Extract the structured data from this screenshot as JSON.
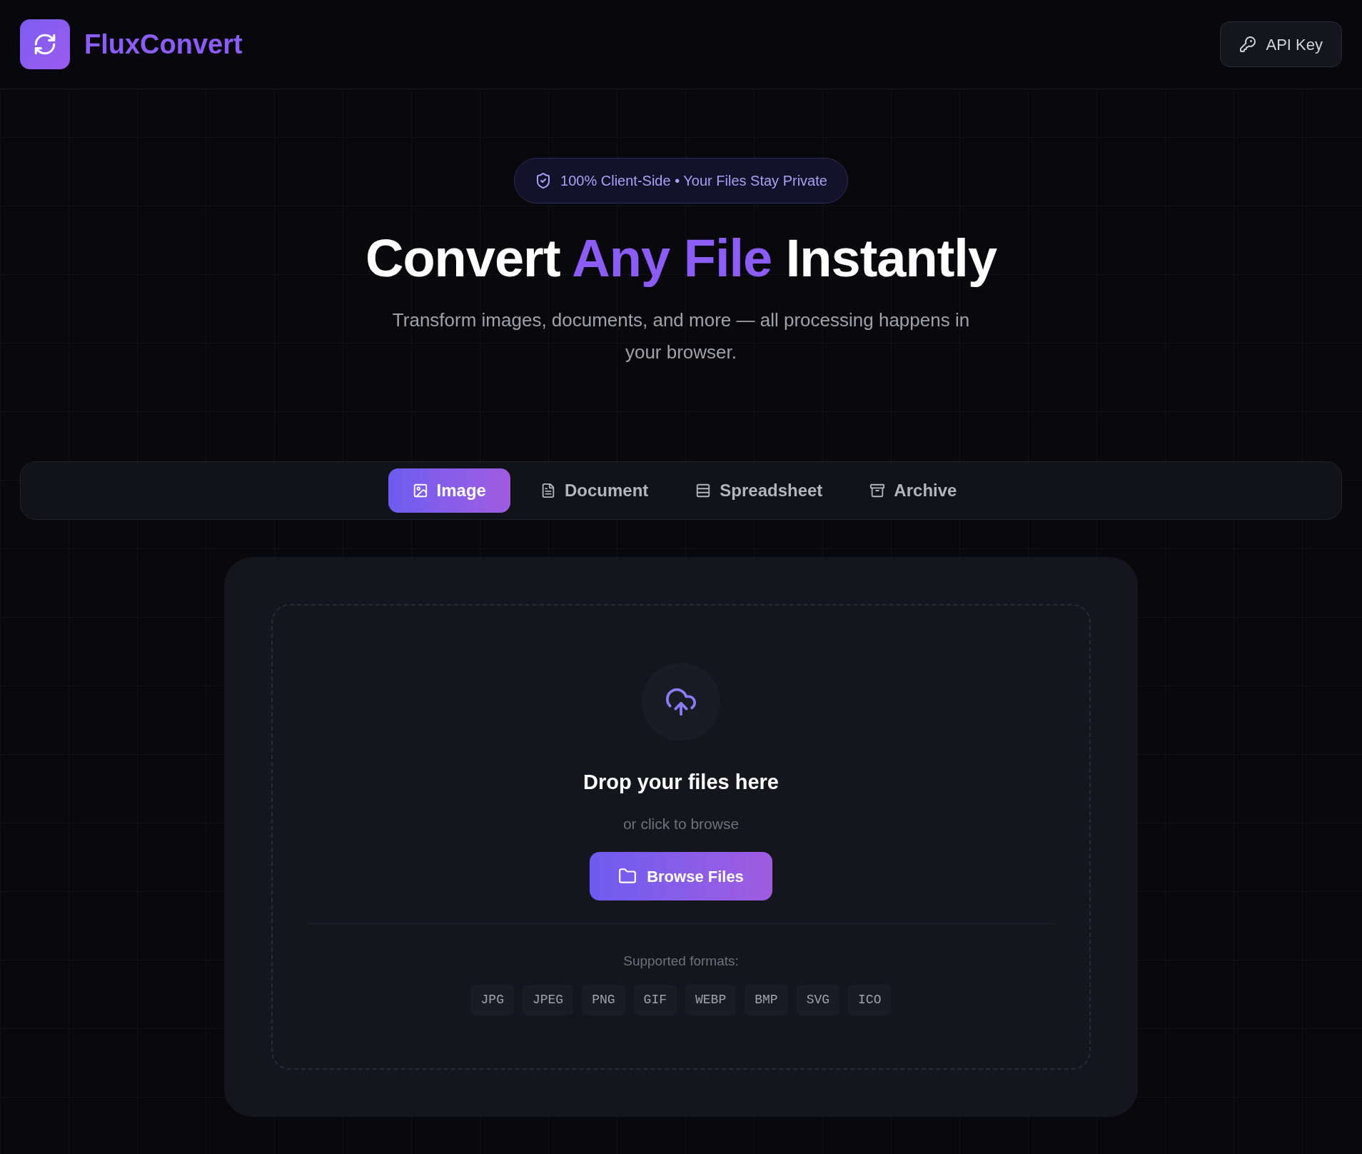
{
  "header": {
    "brand": "FluxConvert",
    "api_button": "API Key"
  },
  "hero": {
    "badge": "100% Client-Side • Your Files Stay Private",
    "title": [
      {
        "text": "Convert",
        "highlight": false
      },
      {
        "text": "Any File",
        "highlight": true
      },
      {
        "text": "Instantly",
        "highlight": false
      }
    ],
    "subtitle": "Transform images, documents, and more — all processing happens in your browser."
  },
  "tabs": [
    {
      "label": "Image",
      "kind": "image",
      "selected": true
    },
    {
      "label": "Document",
      "kind": "document",
      "selected": false
    },
    {
      "label": "Spreadsheet",
      "kind": "spreadsheet",
      "selected": false
    },
    {
      "label": "Archive",
      "kind": "archive",
      "selected": false
    }
  ],
  "dropzone": {
    "title": "Drop your files here",
    "hint": "or click to browse",
    "button": "Browse Files",
    "formats_label": "Supported formats:",
    "formats": [
      "JPG",
      "JPEG",
      "PNG",
      "GIF",
      "WEBP",
      "BMP",
      "SVG",
      "ICO"
    ]
  }
}
